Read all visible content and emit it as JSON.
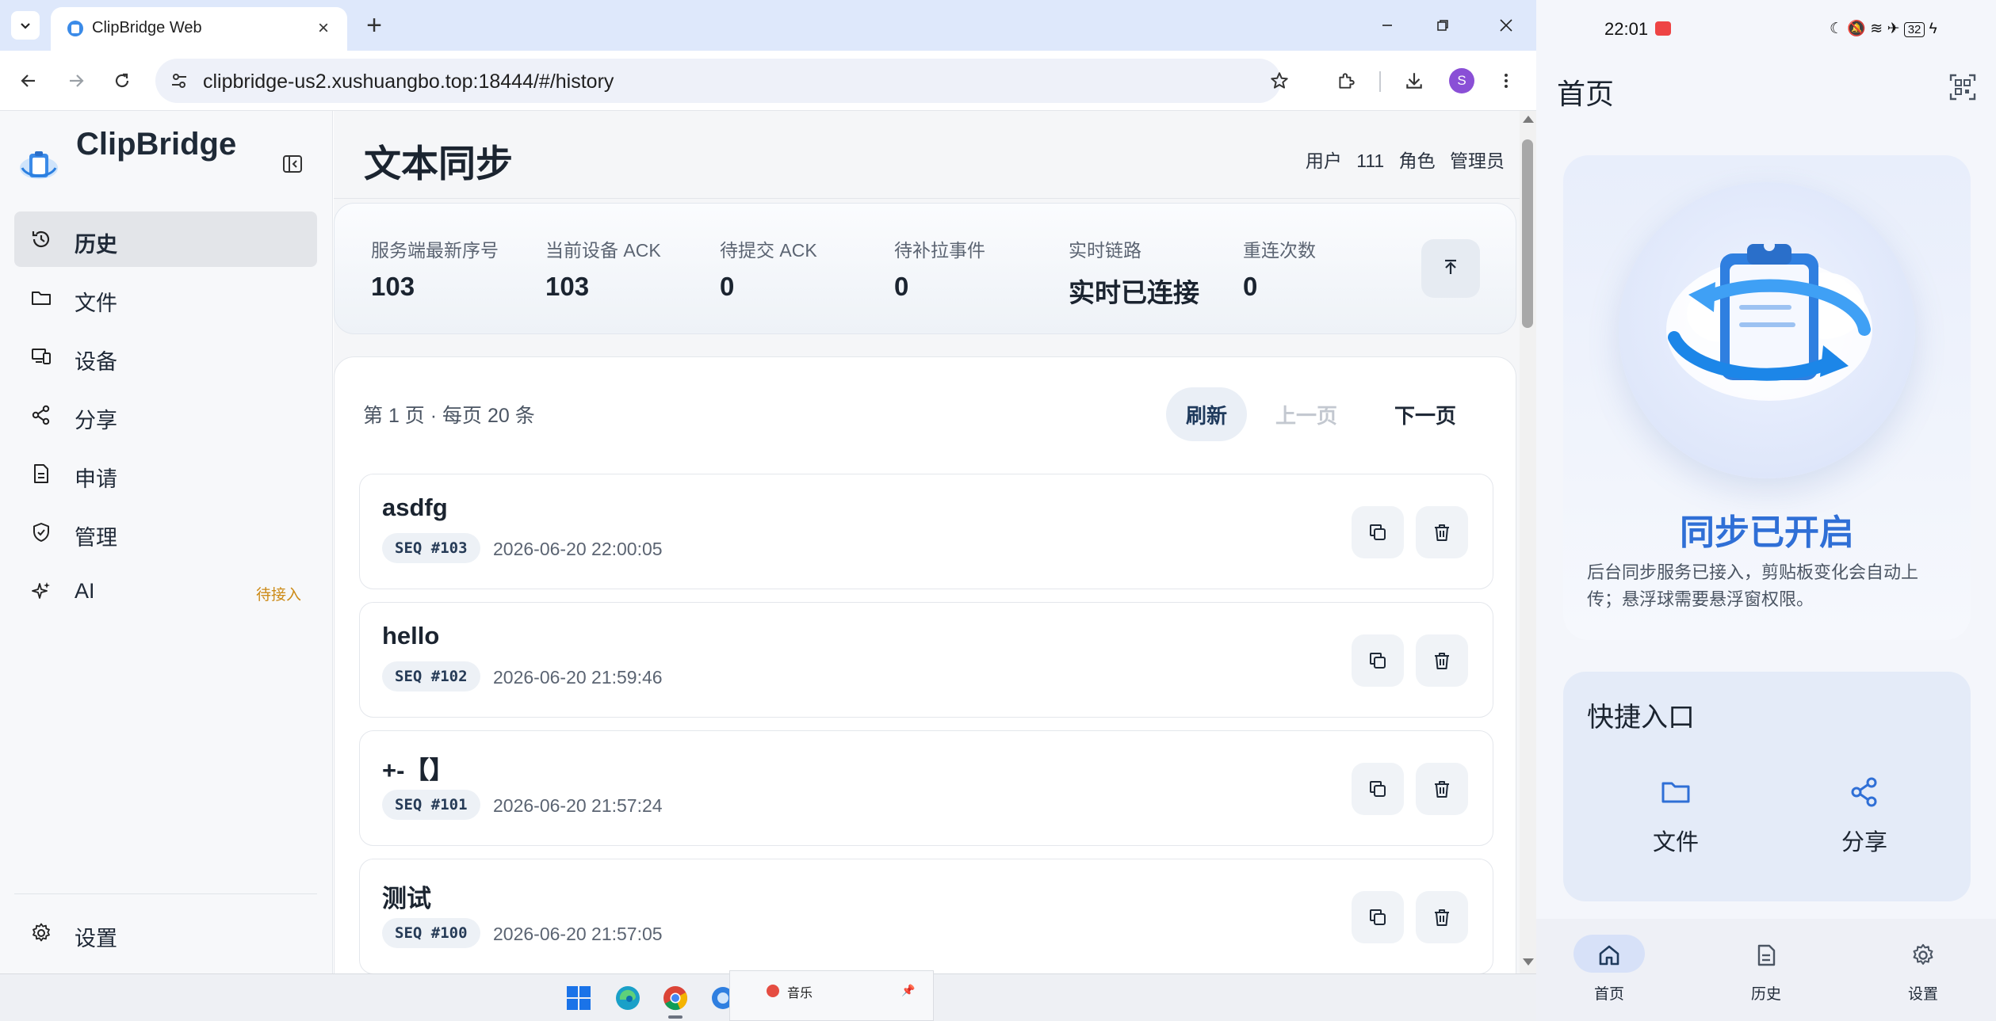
{
  "browser": {
    "tab_title": "ClipBridge Web",
    "url": "clipbridge-us2.xushuangbo.top:18444/#/history",
    "profile_initial": "S"
  },
  "sidebar": {
    "brand": "ClipBridge",
    "items": [
      {
        "label": "历史",
        "icon": "history-icon",
        "active": true
      },
      {
        "label": "文件",
        "icon": "folder-icon"
      },
      {
        "label": "设备",
        "icon": "devices-icon"
      },
      {
        "label": "分享",
        "icon": "share-icon"
      },
      {
        "label": "申请",
        "icon": "document-icon"
      },
      {
        "label": "管理",
        "icon": "shield-icon"
      },
      {
        "label": "AI",
        "icon": "sparkle-icon",
        "badge": "待接入"
      }
    ],
    "settings_label": "设置"
  },
  "main": {
    "title": "文本同步",
    "user_label": "用户",
    "user_value": "111",
    "role_label": "角色",
    "role_value": "管理员",
    "stats": [
      {
        "label": "服务端最新序号",
        "value": "103"
      },
      {
        "label": "当前设备 ACK",
        "value": "103"
      },
      {
        "label": "待提交 ACK",
        "value": "0"
      },
      {
        "label": "待补拉事件",
        "value": "0"
      },
      {
        "label": "实时链路",
        "value": "实时已连接"
      },
      {
        "label": "重连次数",
        "value": "0"
      }
    ],
    "page_info": "第 1 页 · 每页 20 条",
    "refresh_label": "刷新",
    "prev_label": "上一页",
    "next_label": "下一页",
    "items": [
      {
        "text": "asdfg",
        "seq": "SEQ #103",
        "time": "2026-06-20 22:00:05"
      },
      {
        "text": "hello",
        "seq": "SEQ #102",
        "time": "2026-06-20 21:59:46"
      },
      {
        "text": "+-【】",
        "seq": "SEQ #101",
        "time": "2026-06-20 21:57:24"
      },
      {
        "text": "测试",
        "seq": "SEQ #100",
        "time": "2026-06-20 21:57:05"
      }
    ]
  },
  "taskbar": {
    "popup_item": "音乐"
  },
  "phone": {
    "time": "22:01",
    "battery": "32",
    "title": "首页",
    "hero_title": "同步已开启",
    "hero_desc": "后台同步服务已接入，剪贴板变化会自动上传；悬浮球需要悬浮窗权限。",
    "quick_title": "快捷入口",
    "quick_items": [
      {
        "label": "文件",
        "icon": "folder-icon"
      },
      {
        "label": "分享",
        "icon": "share-icon"
      }
    ],
    "nav": [
      {
        "label": "首页",
        "icon": "home-icon",
        "active": true
      },
      {
        "label": "历史",
        "icon": "document-icon"
      },
      {
        "label": "设置",
        "icon": "gear-icon"
      }
    ]
  },
  "colors": {
    "accent": "#2f6fd6",
    "badge_warning": "#cc8a16",
    "tabstrip": "#dee8fb"
  }
}
